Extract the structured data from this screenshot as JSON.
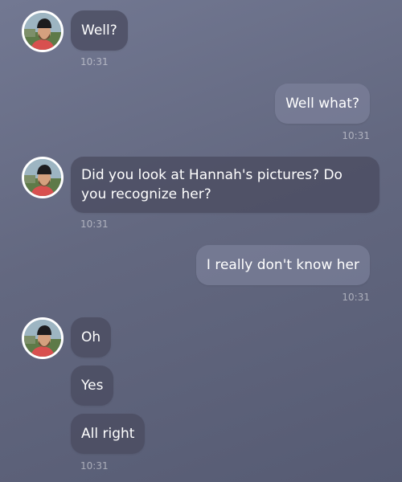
{
  "conversation": {
    "groups": [
      {
        "sender": "contact",
        "avatar_icon": "person-avatar-icon",
        "messages": [
          "Well?"
        ],
        "time": "10:31"
      },
      {
        "sender": "me",
        "messages": [
          "Well what?"
        ],
        "time": "10:31"
      },
      {
        "sender": "contact",
        "avatar_icon": "person-avatar-icon",
        "messages": [
          "Did you look at Hannah's pictures? Do you recognize her?"
        ],
        "time": "10:31"
      },
      {
        "sender": "me",
        "messages": [
          "I really don't know her"
        ],
        "time": "10:31"
      },
      {
        "sender": "contact",
        "avatar_icon": "person-avatar-icon",
        "messages": [
          "Oh",
          "Yes",
          "All right"
        ],
        "time": "10:31"
      }
    ]
  },
  "colors": {
    "background_top": "#727892",
    "background_bottom": "#565b73",
    "incoming_bubble": "#4a4c60",
    "outgoing_bubble": "#80859e",
    "text": "#ffffff"
  }
}
